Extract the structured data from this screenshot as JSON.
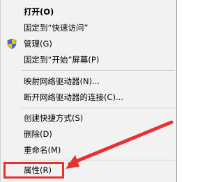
{
  "context_menu": {
    "items": [
      {
        "label": "打开(O)",
        "bold": true
      },
      {
        "label": "固定到“快速访问”"
      },
      {
        "label": "管理(G)",
        "icon": "uac-shield-icon"
      },
      {
        "label": "固定到“开始”屏幕(P)"
      },
      {
        "label": "映射网络驱动器(N)..."
      },
      {
        "label": "断开网络驱动器的连接(C)..."
      },
      {
        "label": "创建快捷方式(S)"
      },
      {
        "label": "删除(D)"
      },
      {
        "label": "重命名(M)"
      },
      {
        "label": "属性(R)"
      }
    ]
  },
  "annotation": {
    "color": "#e8312f",
    "target": "属性(R)"
  }
}
